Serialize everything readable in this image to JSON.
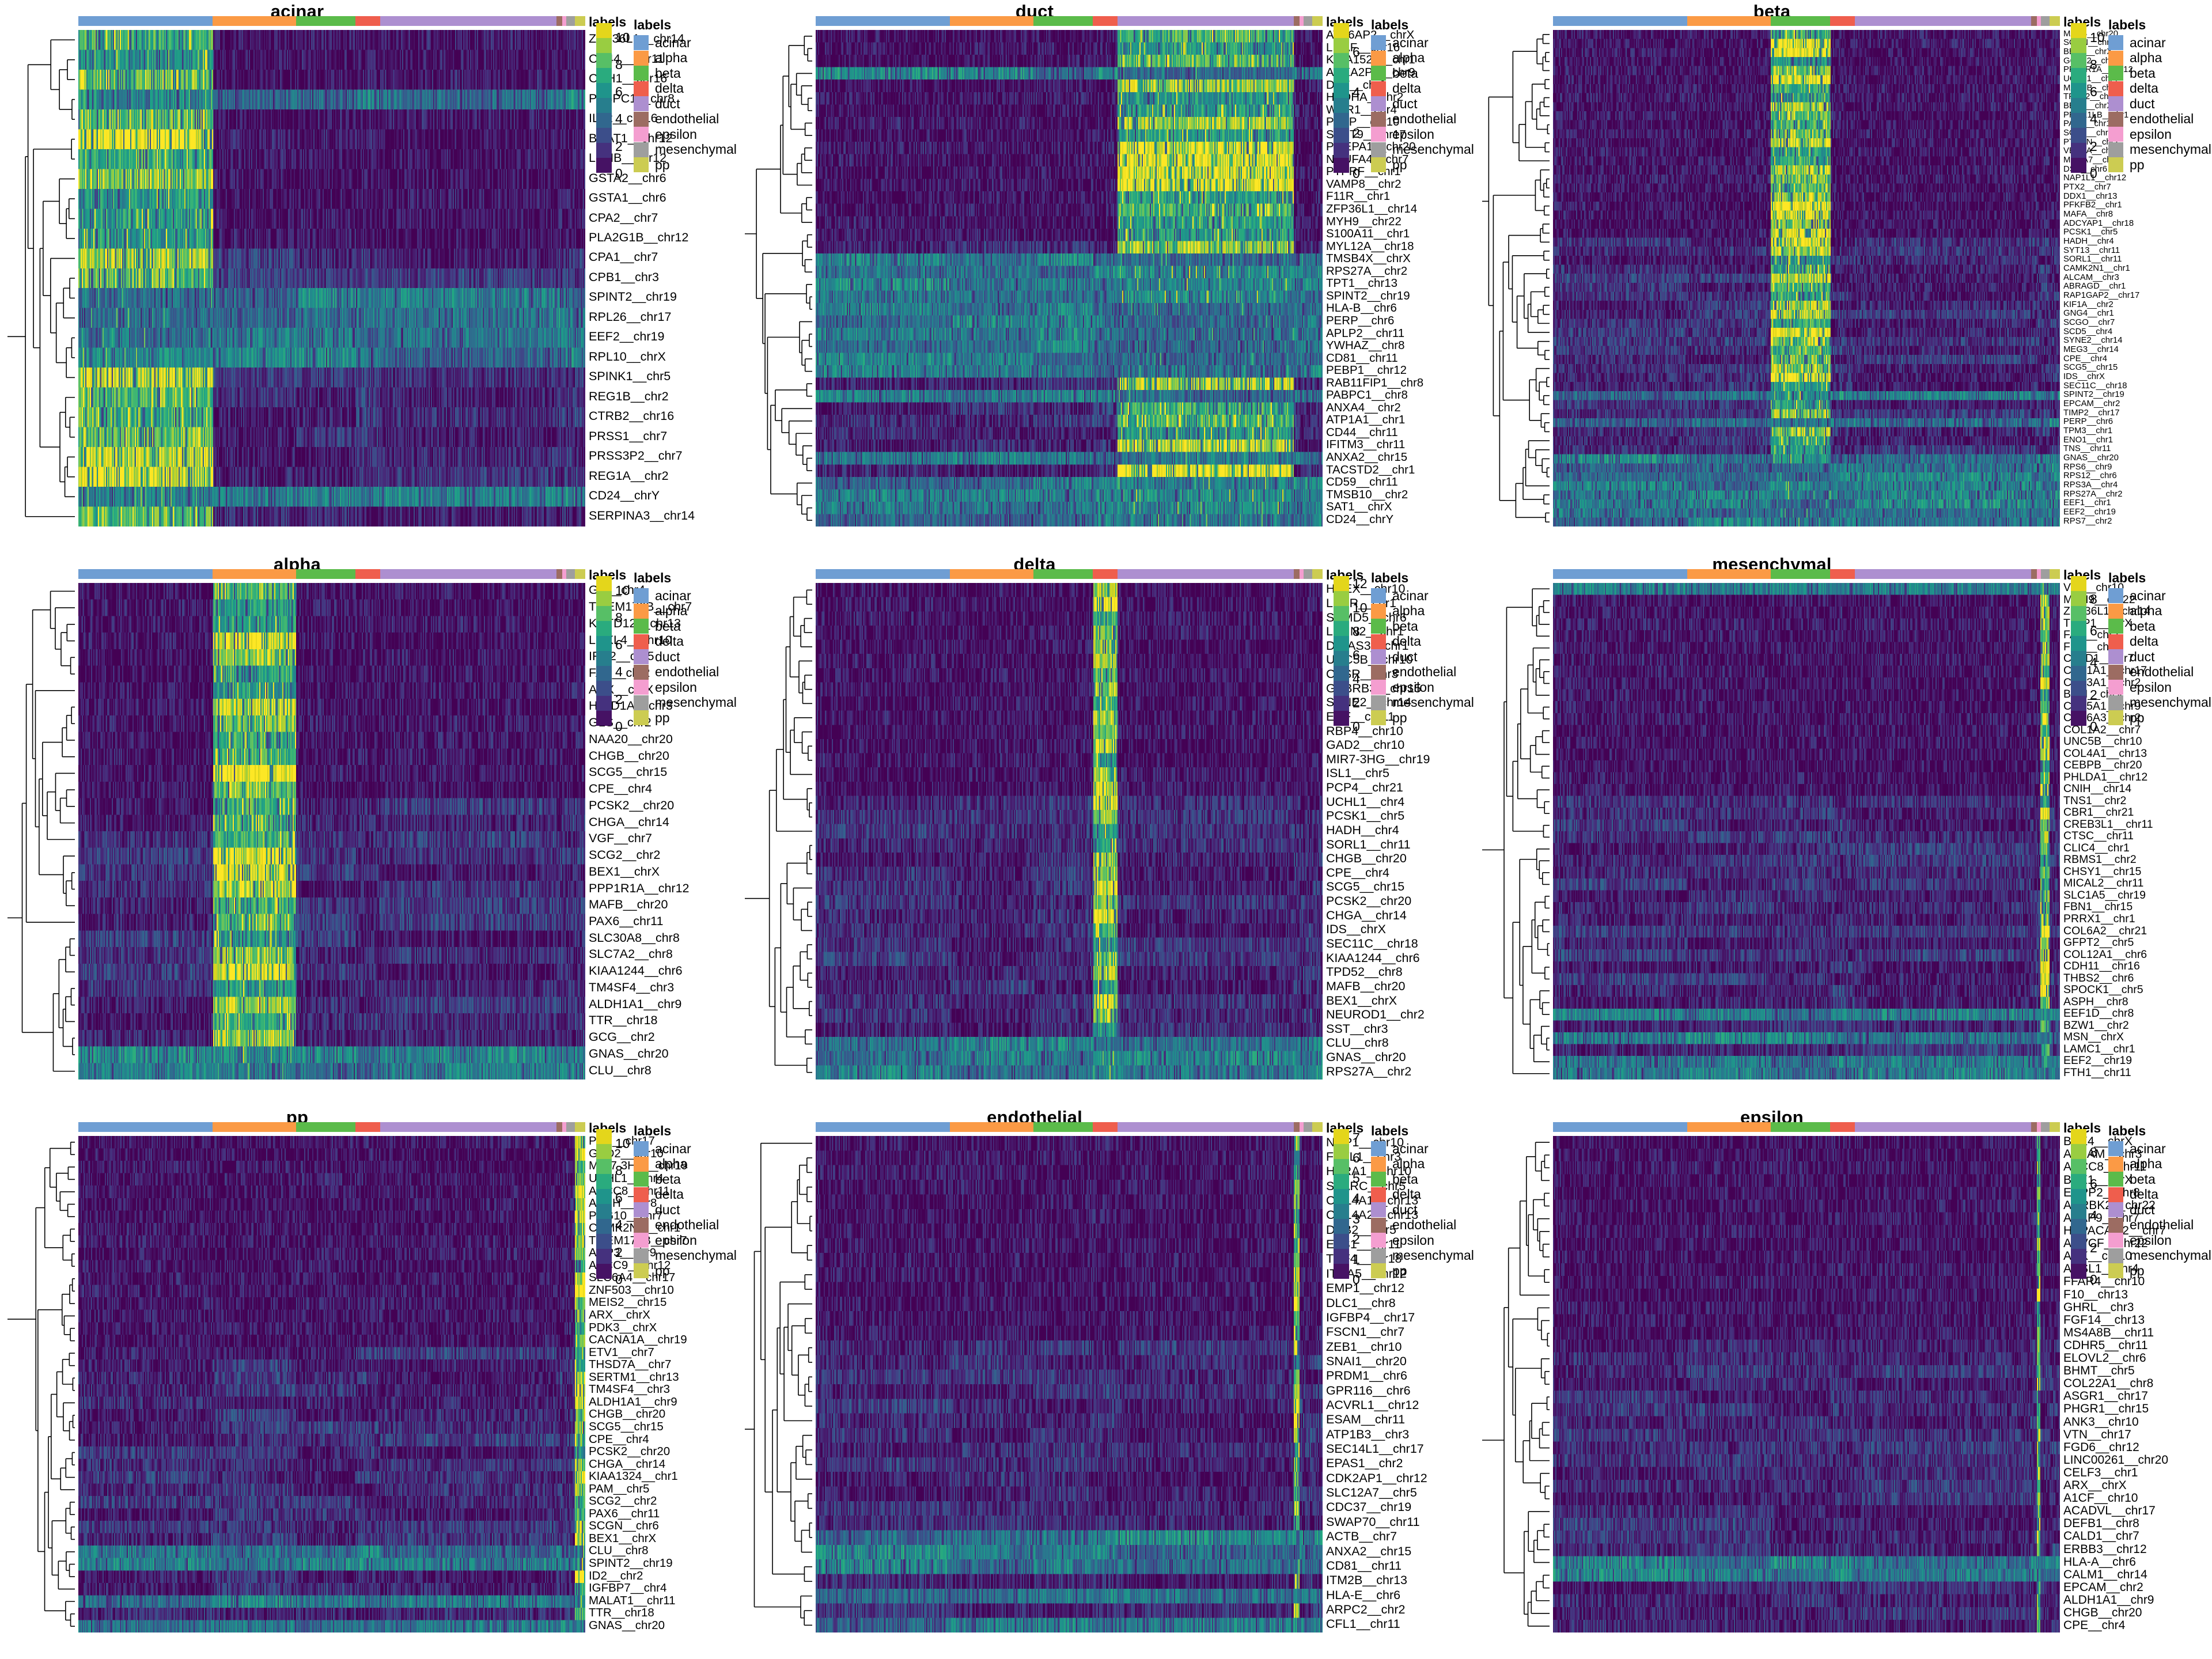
{
  "figure": {
    "annotation_title": "labels",
    "class_legend": [
      {
        "label": "acinar",
        "color": "#6f9ed3"
      },
      {
        "label": "alpha",
        "color": "#fb9a45"
      },
      {
        "label": "beta",
        "color": "#5bbb4a"
      },
      {
        "label": "delta",
        "color": "#ef5e4d"
      },
      {
        "label": "duct",
        "color": "#ad8fd0"
      },
      {
        "label": "endothelial",
        "color": "#9c6c62"
      },
      {
        "label": "epsilon",
        "color": "#f49ed0"
      },
      {
        "label": "mesenchymal",
        "color": "#9e9e9e"
      },
      {
        "label": "pp",
        "color": "#cccc52"
      }
    ],
    "column_blocks": [
      {
        "label": "acinar",
        "color": "#6f9ed3",
        "frac": 0.265
      },
      {
        "label": "alpha",
        "color": "#fb9a45",
        "frac": 0.165
      },
      {
        "label": "beta",
        "color": "#5bbb4a",
        "frac": 0.117
      },
      {
        "label": "delta",
        "color": "#ef5e4d",
        "frac": 0.048
      },
      {
        "label": "duct",
        "color": "#ad8fd0",
        "frac": 0.348
      },
      {
        "label": "endothelial",
        "color": "#9c6c62",
        "frac": 0.012
      },
      {
        "label": "epsilon",
        "color": "#f49ed0",
        "frac": 0.007
      },
      {
        "label": "mesenchymal",
        "color": "#9e9e9e",
        "frac": 0.018
      },
      {
        "label": "pp",
        "color": "#cccc52",
        "frac": 0.02
      }
    ]
  },
  "chart_data": {
    "type": "heatmap",
    "description": "3x3 grid of clustered heatmaps of single-cell gene expression per pancreatic cell type; rows are genes with hierarchical-clustering dendrogram, columns are cells annotated by cell-type label bar.",
    "colormap": "viridis",
    "panels": [
      {
        "title": "acinar",
        "colorbar": {
          "ticks": [
            0,
            2,
            4,
            6,
            8,
            10
          ],
          "min": 0,
          "max": 11
        },
        "genes": [
          "ZFP36L1__chr14",
          "CD44__chr11",
          "CDH1__chr16",
          "PABPC1__chr8",
          "IL32__chr16",
          "BCAT1__chr12",
          "LDHB__chr12",
          "GSTA2__chr6",
          "GSTA1__chr6",
          "CPA2__chr7",
          "PLA2G1B__chr12",
          "CPA1__chr7",
          "CPB1__chr3",
          "SPINT2__chr19",
          "RPL26__chr17",
          "EEF2__chr19",
          "RPL10__chrX",
          "SPINK1__chr5",
          "REG1B__chr2",
          "CTRB2__chr16",
          "PRSS1__chr7",
          "PRSS3P2__chr7",
          "REG1A__chr2",
          "CD24__chrY",
          "SERPINA3__chr14"
        ]
      },
      {
        "title": "duct",
        "colorbar": {
          "ticks": [
            0,
            2,
            4,
            6
          ],
          "min": 0,
          "max": 7.4
        },
        "genes": [
          "ATP6AP2__chrX",
          "LITAF__chr16",
          "KIAA1522__chr1",
          "ANXA2P2__chr9",
          "DST__chr6",
          "HADHA__chr2",
          "WDR1__chr4",
          "PFKP__chr10",
          "SEPT9__chr17",
          "PMEPA1__chr20",
          "NDUFA4__chr7",
          "PTPRF__chr1",
          "VAMP8__chr2",
          "F11R__chr1",
          "ZFP36L1__chr14",
          "MYH9__chr22",
          "S100A11__chr1",
          "MYL12A__chr18",
          "TMSB4X__chrX",
          "RPS27A__chr2",
          "TPT1__chr13",
          "SPINT2__chr19",
          "HLA-B__chr6",
          "PERP__chr6",
          "APLP2__chr11",
          "YWHAZ__chr8",
          "CD81__chr11",
          "PEBP1__chr12",
          "RAB11FIP1__chr8",
          "PABPC1__chr8",
          "ANXA4__chr2",
          "ATP1A1__chr1",
          "CD44__chr11",
          "IFITM3__chr11",
          "ANXA2__chr15",
          "TACSTD2__chr1",
          "CD59__chr11",
          "TMSB10__chr2",
          "SAT1__chrX",
          "CD24__chrY"
        ]
      },
      {
        "title": "beta",
        "colorbar": {
          "ticks": [
            0,
            2,
            4,
            6,
            8,
            10
          ],
          "min": 0,
          "max": 11
        },
        "genes": [
          "MAFB__chr20",
          "SCGN__chr6",
          "BEX1__chrX",
          "G6PC2__chr2",
          "PPP1R1A__chr12",
          "UCHL1__chr4",
          "MAP1B__chr5",
          "TPD52__chr8",
          "BEX2__chrX",
          "PRDX1LB__chr1",
          "PAX6__chr11",
          "SCG3__chr15",
          "PTPRN__chr2",
          "VEGFA__chr6",
          "MXRA7__chr17",
          "DSP__chr6",
          "NAP1L1__chr12",
          "PTX2__chr7",
          "DDX1__chr13",
          "PFKFB2__chr1",
          "MAFA__chr8",
          "ADCYAP1__chr18",
          "PCSK1__chr5",
          "HADH__chr4",
          "SYT13__chr11",
          "SORL1__chr11",
          "CAMK2N1__chr1",
          "ALCAM__chr3",
          "ABRAGD__chr1",
          "RAP1GAP2__chr17",
          "KIF1A__chr2",
          "GNG4__chr1",
          "SCGO__chr7",
          "SCD5__chr4",
          "SYNE2__chr14",
          "MEG3__chr14",
          "CPE__chr4",
          "SCG5__chr15",
          "IDS__chrX",
          "SEC11C__chr18",
          "SPINT2__chr19",
          "EPCAM__chr2",
          "TIMP2__chr17",
          "PERP__chr6",
          "TPM3__chr1",
          "ENO1__chr1",
          "TNS__chr11",
          "GNAS__chr20",
          "RPS6__chr9",
          "RPS12__chr6",
          "RPS3A__chr4",
          "RPS27A__chr2",
          "EEF1__chr1",
          "EEF2__chr19",
          "RPS7__chr2"
        ]
      },
      {
        "title": "alpha",
        "colorbar": {
          "ticks": [
            0,
            2,
            4,
            6,
            8,
            10
          ],
          "min": 0,
          "max": 11
        },
        "genes": [
          "GC__chr4",
          "TMEM176B__chr7",
          "KCTD12__chr13",
          "LOXL4__chr10",
          "IRX2__chr5",
          "FAP__chr2",
          "ARX__chrX",
          "HIGD1A__chr3",
          "GLS__chr2",
          "NAA20__chr20",
          "CHGB__chr20",
          "SCG5__chr15",
          "CPE__chr4",
          "PCSK2__chr20",
          "CHGA__chr14",
          "VGF__chr7",
          "SCG2__chr2",
          "BEX1__chrX",
          "PPP1R1A__chr12",
          "MAFB__chr20",
          "PAX6__chr11",
          "SLC30A8__chr8",
          "SLC7A2__chr8",
          "KIAA1244__chr6",
          "TM4SF4__chr3",
          "ALDH1A1__chr9",
          "TTR__chr18",
          "GCG__chr2",
          "GNAS__chr20",
          "CLU__chr8"
        ]
      },
      {
        "title": "delta",
        "colorbar": {
          "ticks": [
            0,
            2,
            4,
            6,
            8,
            10,
            12
          ],
          "min": 0,
          "max": 12.6
        },
        "genes": [
          "HHEX__chr10",
          "LEPR__chr1",
          "SAMD5__chr6",
          "LPHN2__chr1",
          "DIRAS3__chr1",
          "UNC5B__chr10",
          "CASR__chr3",
          "GABRB3__chr15",
          "SYNE2__chr14",
          "EHF__chr11",
          "RBP4__chr10",
          "GAD2__chr10",
          "MIR7-3HG__chr19",
          "ISL1__chr5",
          "PCP4__chr21",
          "UCHL1__chr4",
          "PCSK1__chr5",
          "HADH__chr4",
          "SORL1__chr11",
          "CHGB__chr20",
          "CPE__chr4",
          "SCG5__chr15",
          "PCSK2__chr20",
          "CHGA__chr14",
          "IDS__chrX",
          "SEC11C__chr18",
          "KIAA1244__chr6",
          "TPD52__chr8",
          "MAFB__chr20",
          "BEX1__chrX",
          "NEUROD1__chr2",
          "SST__chr3",
          "CLU__chr8",
          "GNAS__chr20",
          "RPS27A__chr2"
        ]
      },
      {
        "title": "mesenchymal",
        "colorbar": {
          "ticks": [
            0,
            2,
            4,
            6,
            8
          ],
          "min": 0,
          "max": 9.4
        },
        "genes": [
          "VIM__chr10",
          "MYH9__chr22",
          "ZFP36L1__chr14",
          "TIMP1__chrX",
          "FAP__chr2",
          "FN1__chr2",
          "CALD1__chr7",
          "COL1A1__chr17",
          "COL3A1__chr2",
          "BGN__chrX",
          "COL5A1__chr9",
          "COL6A3__chr2",
          "COL1A2__chr7",
          "UNC5B__chr10",
          "COL4A1__chr13",
          "CEBPB__chr20",
          "PHLDA1__chr12",
          "CNIH__chr14",
          "TNS1__chr2",
          "CBR1__chr21",
          "CREB3L1__chr11",
          "CTSC__chr11",
          "CLIC4__chr1",
          "RBMS1__chr2",
          "CHSY1__chr15",
          "MICAL2__chr11",
          "SLC1A5__chr19",
          "FBN1__chr15",
          "PRRX1__chr1",
          "COL6A2__chr21",
          "GFPT2__chr5",
          "COL12A1__chr6",
          "CDH11__chr16",
          "THBS2__chr6",
          "SPOCK1__chr5",
          "ASPH__chr8",
          "EEF1D__chr8",
          "BZW1__chr2",
          "MSN__chrX",
          "LAMC1__chr1",
          "EEF2__chr19",
          "FTH1__chr11"
        ]
      },
      {
        "title": "pp",
        "colorbar": {
          "ticks": [
            0,
            2,
            4,
            6,
            8,
            10
          ],
          "min": 0,
          "max": 11
        },
        "genes": [
          "PPY__chr17",
          "GAD2__chr10",
          "MIR7-3HG__chr19",
          "UCHL1__chr4",
          "ABCC8__chr11",
          "ASPH__chr8",
          "PEG10__chr7",
          "CAMK2N1__chr1",
          "TMEM176B__chr7",
          "AQP3__chr9",
          "ABCC9__chr12",
          "SLC6A4__chr17",
          "ZNF503__chr10",
          "MEIS2__chr15",
          "ARX__chrX",
          "PDK3__chrX",
          "CACNA1A__chr19",
          "ETV1__chr7",
          "THSD7A__chr7",
          "SERTM1__chr13",
          "TM4SF4__chr3",
          "ALDH1A1__chr9",
          "CHGB__chr20",
          "SCG5__chr15",
          "CPE__chr4",
          "PCSK2__chr20",
          "CHGA__chr14",
          "KIAA1324__chr1",
          "PAM__chr5",
          "SCG2__chr2",
          "PAX6__chr11",
          "SCGN__chr6",
          "BEX1__chrX",
          "CLU__chr8",
          "SPINT2__chr19",
          "ID2__chr2",
          "IGFBP7__chr4",
          "MALAT1__chr11",
          "TTR__chr18",
          "GNAS__chr20"
        ]
      },
      {
        "title": "endothelial",
        "colorbar": {
          "ticks": [
            0,
            1,
            2,
            3,
            4,
            5,
            6,
            7
          ],
          "min": 0,
          "max": 7.4
        },
        "genes": [
          "NRP1__chr10",
          "FSTL1__chr3",
          "HTRA1__chr10",
          "SPARC__chr5",
          "COL4A1__chr13",
          "COL4A2__chr13",
          "DAB2__chr5",
          "ETS1__chr11",
          "TCF4__chr18",
          "ITGA5__chr12",
          "EMP1__chr12",
          "DLC1__chr8",
          "IGFBP4__chr17",
          "FSCN1__chr7",
          "ZEB1__chr10",
          "SNAI1__chr20",
          "PRDM1__chr6",
          "GPR116__chr6",
          "ACVRL1__chr12",
          "ESAM__chr11",
          "ATP1B3__chr3",
          "SEC14L1__chr17",
          "EPAS1__chr2",
          "CDK2AP1__chr12",
          "SLC12A7__chr5",
          "CDC37__chr19",
          "SWAP70__chr11",
          "ACTB__chr7",
          "ANXA2__chr15",
          "CD81__chr11",
          "ITM2B__chr13",
          "HLA-E__chr6",
          "ARPC2__chr2",
          "CFL1__chr11"
        ]
      },
      {
        "title": "epsilon",
        "colorbar": {
          "ticks": [
            0,
            2,
            4,
            6,
            8
          ],
          "min": 0,
          "max": 9.4
        },
        "genes": [
          "BEX4__chrX",
          "ALCAM__chr3",
          "ABCC8__chr11",
          "BEX1__chrX",
          "ENPP2__chr8",
          "ADRBK2__chr22",
          "AKAP9__chr7",
          "HEPACAM2__chr7",
          "ARVCF__chr22",
          "ADK__chr10",
          "ACSL1__chr4",
          "FFAR4__chr10",
          "F10__chr13",
          "GHRL__chr3",
          "FGF14__chr13",
          "MS4A8B__chr11",
          "CDHR5__chr11",
          "ELOVL2__chr6",
          "BHMT__chr5",
          "COL22A1__chr8",
          "ASGR1__chr17",
          "PHGR1__chr15",
          "ANK3__chr10",
          "VTN__chr17",
          "FGD6__chr12",
          "LINC00261__chr20",
          "CELF3__chr1",
          "ARX__chrX",
          "A1CF__chr10",
          "ACADVL__chr17",
          "DEFB1__chr8",
          "CALD1__chr7",
          "ERBB3__chr12",
          "HLA-A__chr6",
          "CALM1__chr14",
          "EPCAM__chr2",
          "ALDH1A1__chr9",
          "CHGB__chr20",
          "CPE__chr4"
        ]
      }
    ]
  }
}
